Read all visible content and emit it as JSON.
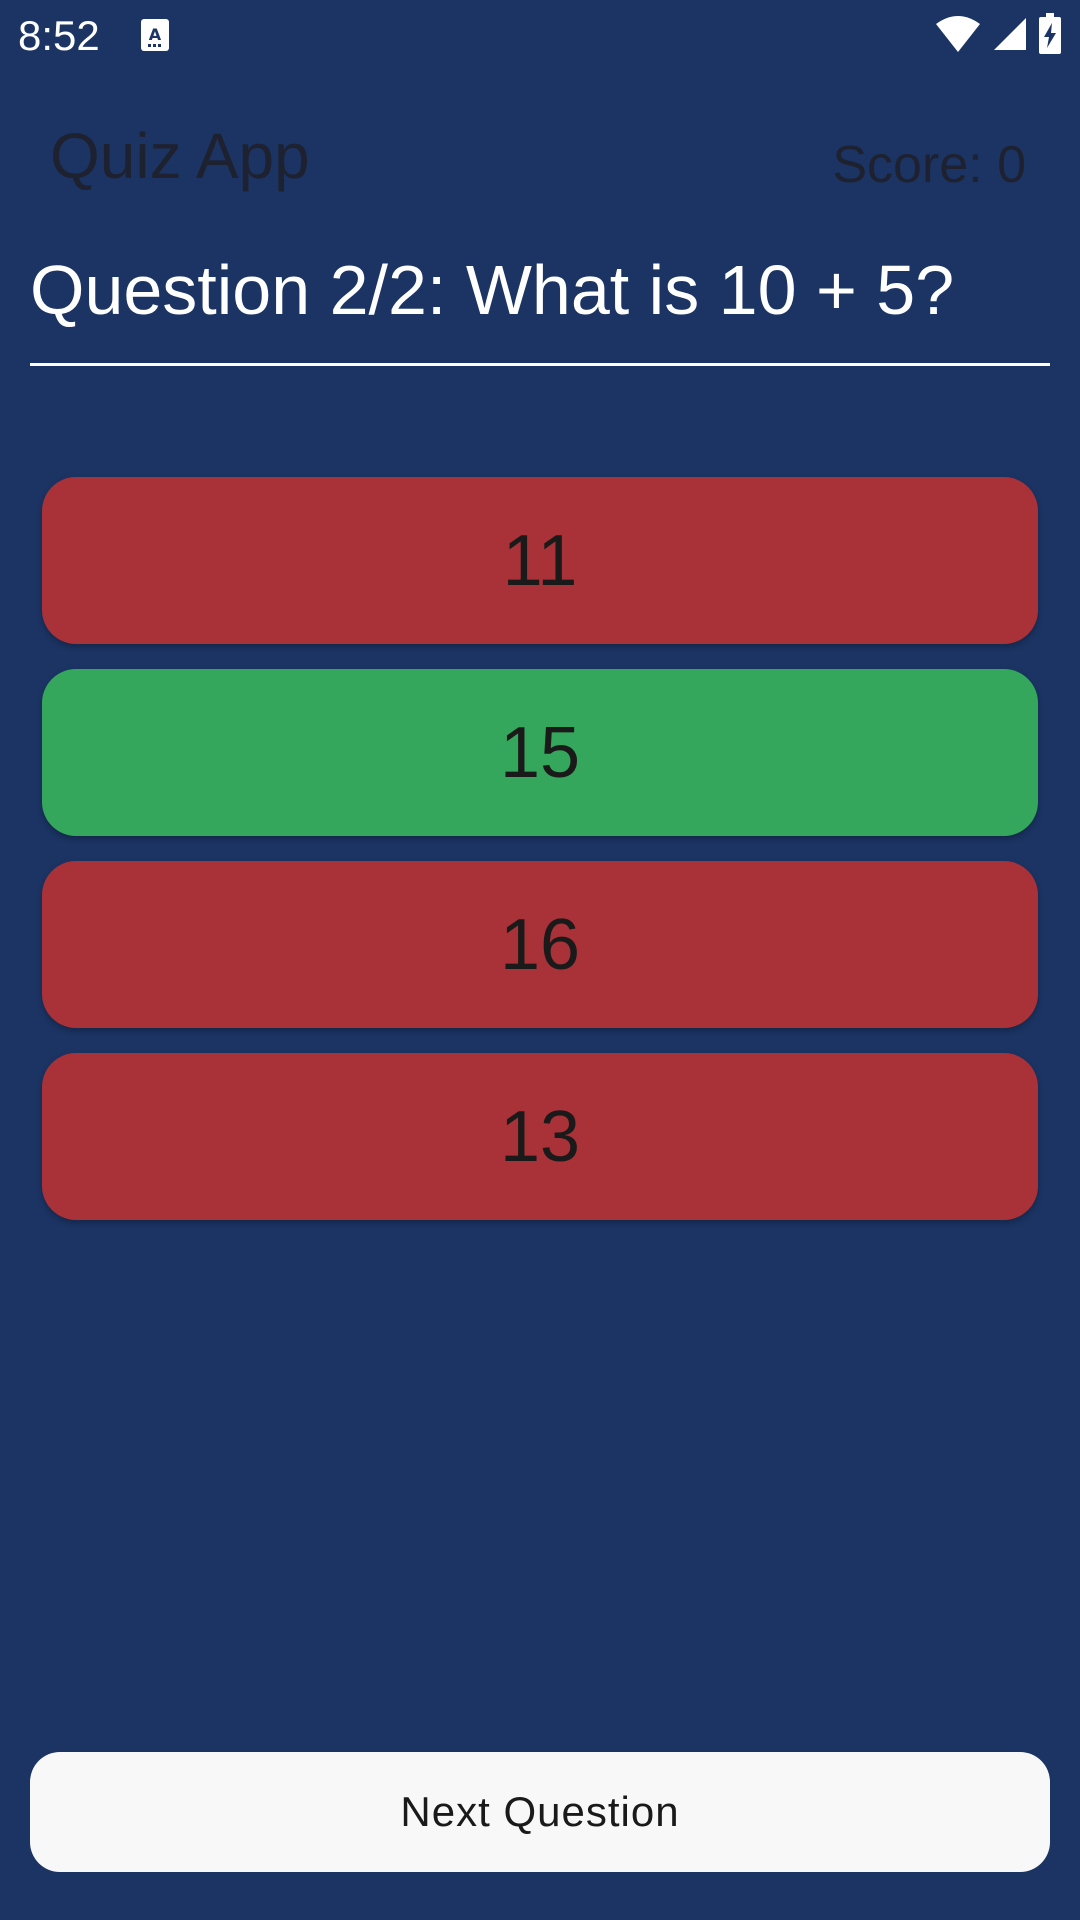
{
  "status_bar": {
    "time": "8:52",
    "icons": [
      "text-input-notification-icon",
      "wifi-icon",
      "cellular-signal-icon",
      "battery-charging-icon"
    ]
  },
  "header": {
    "app_title": "Quiz App",
    "score": "Score: 0"
  },
  "question": {
    "text": "Question 2/2: What is 10 + 5?"
  },
  "options": [
    {
      "label": "11",
      "state": "wrong",
      "color": "#a83238"
    },
    {
      "label": "15",
      "state": "correct",
      "color": "#35a75d"
    },
    {
      "label": "16",
      "state": "wrong",
      "color": "#a83238"
    },
    {
      "label": "13",
      "state": "wrong",
      "color": "#a83238"
    }
  ],
  "next_button": {
    "label": "Next Question"
  },
  "colors": {
    "background": "#1b3463",
    "correct": "#35a75d",
    "wrong": "#a83238",
    "button": "#f8f8f8"
  }
}
